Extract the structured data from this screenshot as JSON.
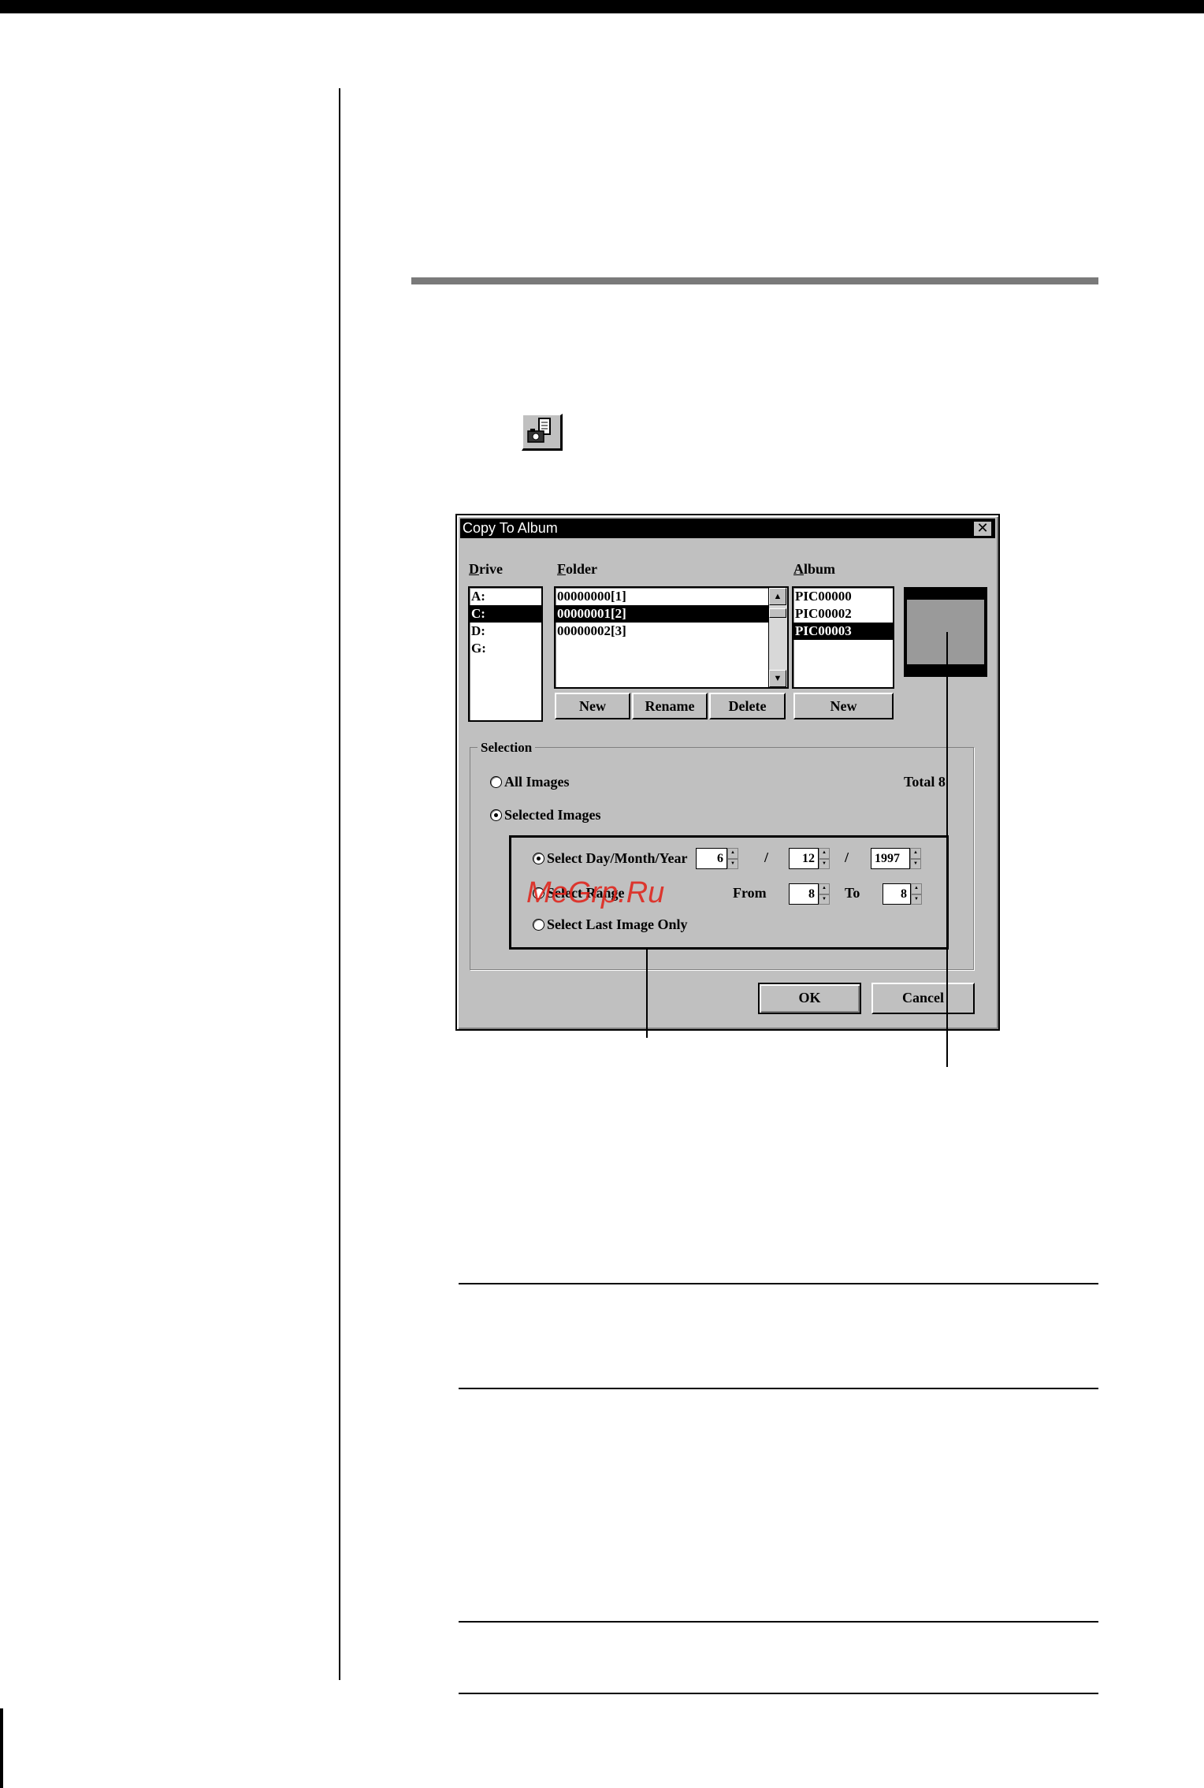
{
  "dialog": {
    "title": "Copy To Album",
    "close_glyph": "✕",
    "drive": {
      "label_key": "D",
      "label_rest": "rive",
      "items": [
        "A:",
        "C:",
        "D:",
        "G:"
      ],
      "selected_index": 1
    },
    "folder": {
      "label_key": "F",
      "label_rest": "older",
      "items": [
        "00000000[1]",
        "00000001[2]",
        "00000002[3]"
      ],
      "selected_index": 1,
      "buttons": [
        "New",
        "Rename",
        "Delete"
      ]
    },
    "album": {
      "label_key": "A",
      "label_rest": "lbum",
      "items": [
        "PIC00000",
        "PIC00002",
        "PIC00003"
      ],
      "selected_index": 2,
      "button": "New"
    },
    "selection": {
      "title": "Selection",
      "all_images": "All Images",
      "selected_images": "Selected Images",
      "total": "Total 8",
      "selected_mode": "selected_images",
      "select_date": "Select Day/Month/Year",
      "day": "6",
      "month": "12",
      "year": "1997",
      "date_sep": "/",
      "select_range": "Select Range",
      "from_label": "From",
      "from_value": "8",
      "to_label": "To",
      "to_value": "8",
      "select_last": "Select Last Image Only",
      "sub_mode": "day_month_year"
    },
    "ok": "OK",
    "cancel": "Cancel"
  },
  "watermark": "MeGrp.Ru"
}
